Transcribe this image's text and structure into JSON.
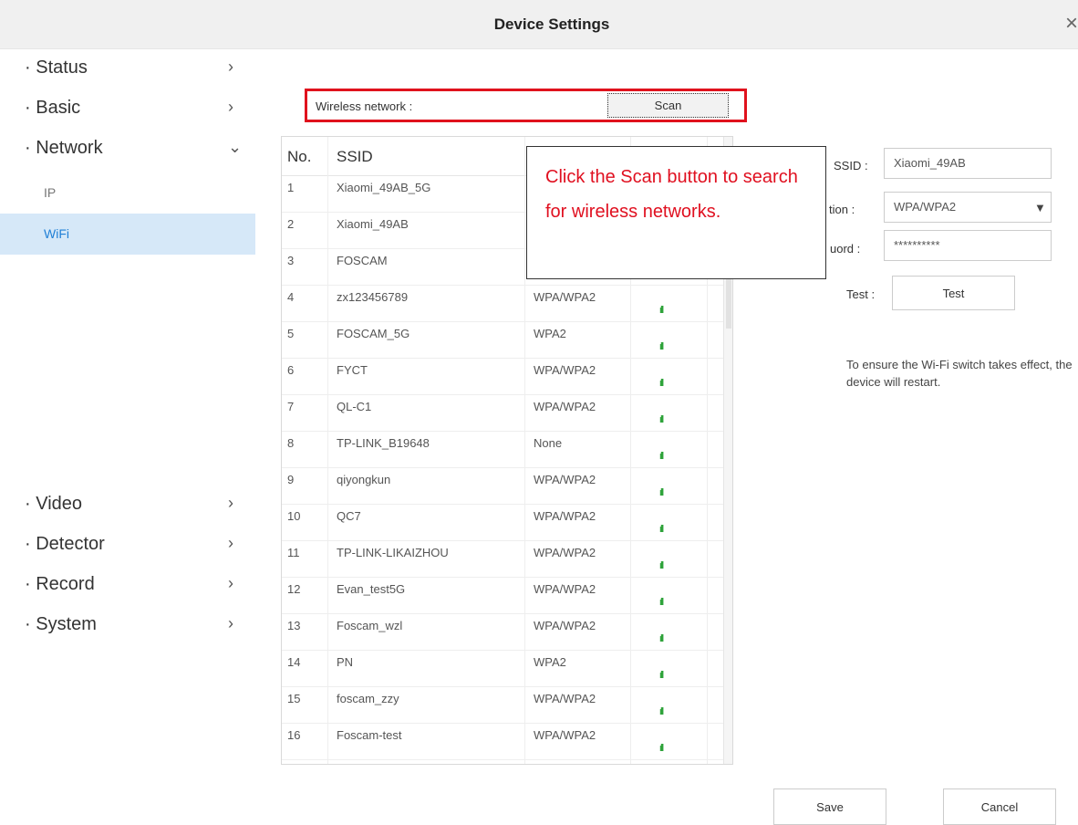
{
  "window": {
    "title": "Device Settings",
    "close_glyph": "×"
  },
  "sidebar": {
    "items": [
      {
        "label": "Status",
        "chevron": "›"
      },
      {
        "label": "Basic",
        "chevron": "›"
      },
      {
        "label": "Network",
        "chevron": "⌄"
      },
      {
        "label": "Video",
        "chevron": "›"
      },
      {
        "label": "Detector",
        "chevron": "›"
      },
      {
        "label": "Record",
        "chevron": "›"
      },
      {
        "label": "System",
        "chevron": "›"
      }
    ],
    "bullet": "·",
    "subitems": [
      {
        "label": "IP"
      },
      {
        "label": "WiFi"
      }
    ]
  },
  "wireless": {
    "label": "Wireless network :",
    "scan_button": "Scan"
  },
  "table": {
    "headers": [
      "No.",
      "SSID"
    ],
    "signal_glyph": "ıll",
    "rows": [
      {
        "no": "1",
        "ssid": "Xiaomi_49AB_5G",
        "enc": ""
      },
      {
        "no": "2",
        "ssid": "Xiaomi_49AB",
        "enc": ""
      },
      {
        "no": "3",
        "ssid": "FOSCAM",
        "enc": ""
      },
      {
        "no": "4",
        "ssid": "zx123456789",
        "enc": "WPA/WPA2"
      },
      {
        "no": "5",
        "ssid": "FOSCAM_5G",
        "enc": "WPA2"
      },
      {
        "no": "6",
        "ssid": "FYCT",
        "enc": "WPA/WPA2"
      },
      {
        "no": "7",
        "ssid": "QL-C1",
        "enc": "WPA/WPA2"
      },
      {
        "no": "8",
        "ssid": "TP-LINK_B19648",
        "enc": "None"
      },
      {
        "no": "9",
        "ssid": "qiyongkun",
        "enc": "WPA/WPA2"
      },
      {
        "no": "10",
        "ssid": "QC7",
        "enc": "WPA/WPA2"
      },
      {
        "no": "11",
        "ssid": "TP-LINK-LIKAIZHOU",
        "enc": "WPA/WPA2"
      },
      {
        "no": "12",
        "ssid": "Evan_test5G",
        "enc": "WPA/WPA2"
      },
      {
        "no": "13",
        "ssid": "Foscam_wzl",
        "enc": "WPA/WPA2"
      },
      {
        "no": "14",
        "ssid": "PN",
        "enc": "WPA2"
      },
      {
        "no": "15",
        "ssid": "foscam_zzy",
        "enc": "WPA/WPA2"
      },
      {
        "no": "16",
        "ssid": "Foscam-test",
        "enc": "WPA/WPA2"
      }
    ]
  },
  "form": {
    "ssid_label": "SSID :",
    "ssid_value": "Xiaomi_49AB",
    "encryption_label": "tion :",
    "encryption_value": "WPA/WPA2",
    "password_label": "uord :",
    "password_value": "**********",
    "test_label": "Test :",
    "test_button": "Test",
    "note": "To ensure the Wi-Fi switch takes effect, the device will restart."
  },
  "callout": {
    "text": "Click the Scan button to search for wireless networks."
  },
  "footer": {
    "save": "Save",
    "cancel": "Cancel"
  },
  "colors": {
    "highlight": "#e0121d",
    "active_bg": "#d6e8f8",
    "active_text": "#1f7fd6",
    "signal": "#2fa33b"
  }
}
